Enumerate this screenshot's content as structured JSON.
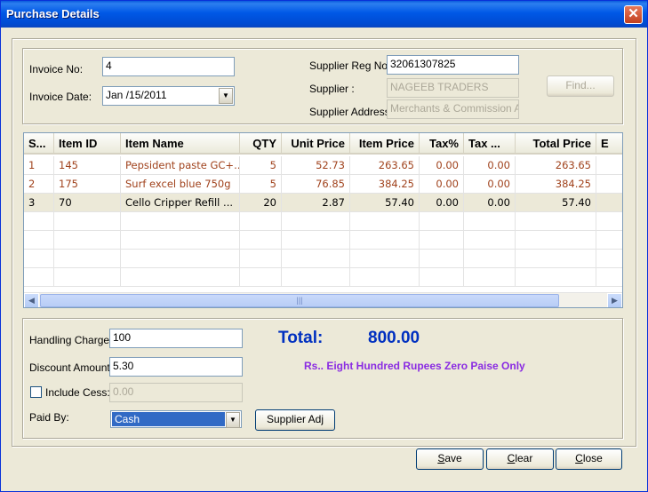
{
  "window": {
    "title": "Purchase Details",
    "close_glyph": "✕"
  },
  "invoice": {
    "no_label": "Invoice No:",
    "no_value": "4",
    "date_label": "Invoice Date:",
    "date_value": "Jan /15/2011"
  },
  "supplier": {
    "reg_label": "Supplier Reg No:",
    "reg_value": "32061307825",
    "name_label": "Supplier :",
    "name_value": "NAGEEB TRADERS",
    "address_label": "Supplier Address:",
    "address_value": "Merchants & Commission Age",
    "find_label": "Find..."
  },
  "grid": {
    "columns": [
      "S...",
      "Item ID",
      "Item Name",
      "QTY",
      "Unit Price",
      "Item Price",
      "Tax%",
      "Tax ...",
      "Total Price",
      "E"
    ],
    "rows": [
      {
        "sno": "1",
        "item_id": "145",
        "name": "Pepsident paste GC+...",
        "qty": "5",
        "unit_price": "52.73",
        "item_price": "263.65",
        "tax_pct": "0.00",
        "tax": "0.00",
        "total": "263.65"
      },
      {
        "sno": "2",
        "item_id": "175",
        "name": "Surf excel blue 750g",
        "qty": "5",
        "unit_price": "76.85",
        "item_price": "384.25",
        "tax_pct": "0.00",
        "tax": "0.00",
        "total": "384.25"
      },
      {
        "sno": "3",
        "item_id": "70",
        "name": "Cello Cripper Refill ...",
        "qty": "20",
        "unit_price": "2.87",
        "item_price": "57.40",
        "tax_pct": "0.00",
        "tax": "0.00",
        "total": "57.40"
      }
    ],
    "scroll_grip": "|||"
  },
  "charges": {
    "handling_label": "Handling Charges:",
    "handling_value": "100",
    "discount_label": "Discount Amount:",
    "discount_value": "5.30",
    "cess_label": "Include Cess:",
    "cess_value": "0.00",
    "paid_by_label": "Paid By:",
    "paid_by_value": "Cash",
    "supplier_adj_label": "Supplier Adj"
  },
  "summary": {
    "total_label": "Total:",
    "total_value": "800.00",
    "amount_words": "Rs.. Eight Hundred  Rupees Zero Paise Only"
  },
  "actions": {
    "save_key": "S",
    "save_rest": "ave",
    "clear_key": "C",
    "clear_rest": "lear",
    "close_key": "C",
    "close_rest": "lose"
  },
  "colors": {
    "title_bar": "#0058e6",
    "total_text": "#0030c0",
    "words_text": "#8a2be2",
    "row_text_red": "#a0421c",
    "selected_row": "#ece9d8",
    "selection": "#316ac5"
  }
}
